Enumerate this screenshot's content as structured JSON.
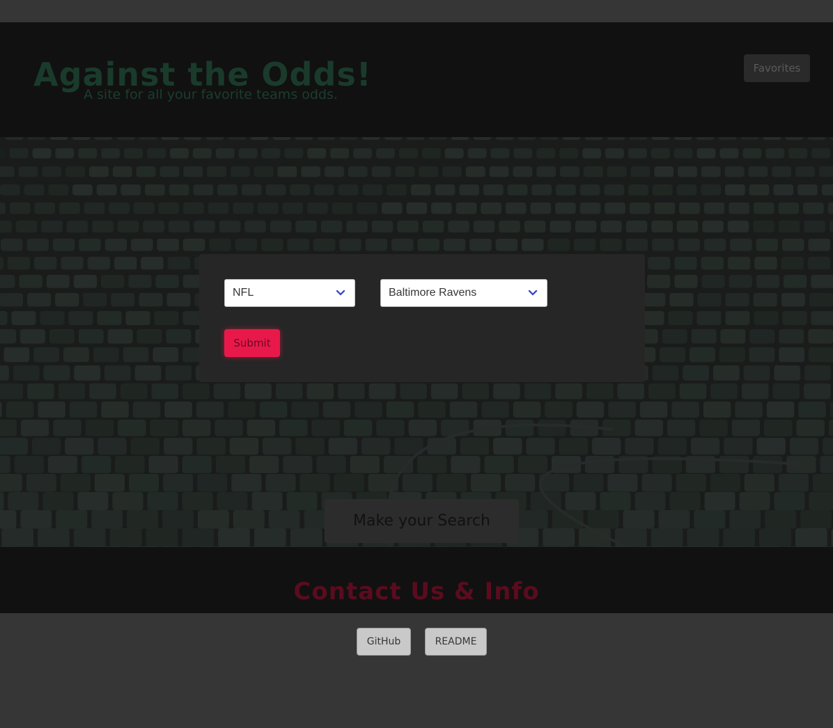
{
  "header": {
    "title": "Against the Odds!",
    "subtitle": "A site for all your favorite teams odds.",
    "favorites_label": "Favorites"
  },
  "hero": {
    "background": "stadium-seats-image",
    "search_button_label": "Make your Search"
  },
  "modal": {
    "league_select": {
      "selected": "NFL",
      "icon": "chevron-down-icon"
    },
    "team_select": {
      "selected": "Baltimore Ravens",
      "icon": "chevron-down-icon"
    },
    "submit_label": "Submit"
  },
  "footer": {
    "contact_title": "Contact Us & Info",
    "github_label": "GitHub",
    "readme_label": "README"
  },
  "colors": {
    "page_bg": "#363636",
    "header_bg": "#111111",
    "title_green": "#1a3b2c",
    "submit_red": "#e8194a",
    "contact_red": "#5a0c1e",
    "chevron_blue": "#3d4ec5"
  }
}
